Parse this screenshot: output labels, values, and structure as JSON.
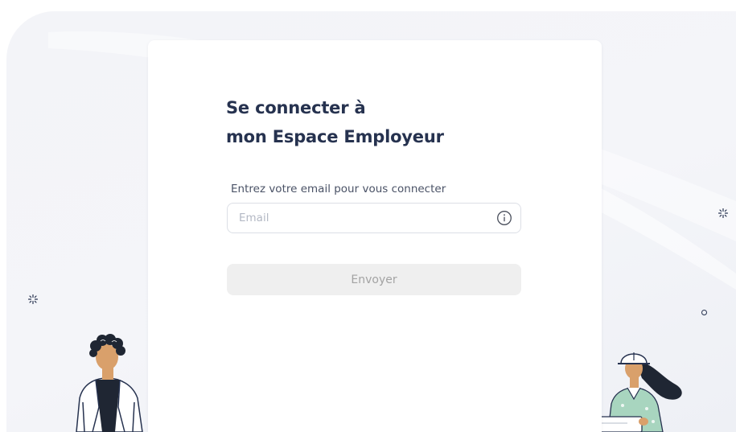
{
  "login": {
    "title_line1": "Se connecter à",
    "title_line2": "mon Espace Employeur",
    "email_label": "Entrez votre email pour vous connecter",
    "email_placeholder": "Email",
    "email_value": "",
    "submit_label": "Envoyer",
    "submit_state": "disabled"
  },
  "icons": {
    "info": "info-circle-icon",
    "sparkles": [
      "sparkle-icon",
      "sparkle-icon"
    ],
    "dot": "circle-dot-icon"
  },
  "colors": {
    "title": "#26324f",
    "background": "#f4f5f9",
    "card": "#ffffff",
    "button_disabled_bg": "#efefef",
    "button_disabled_text": "#a3a3a3",
    "input_border": "#dcdfe6"
  }
}
